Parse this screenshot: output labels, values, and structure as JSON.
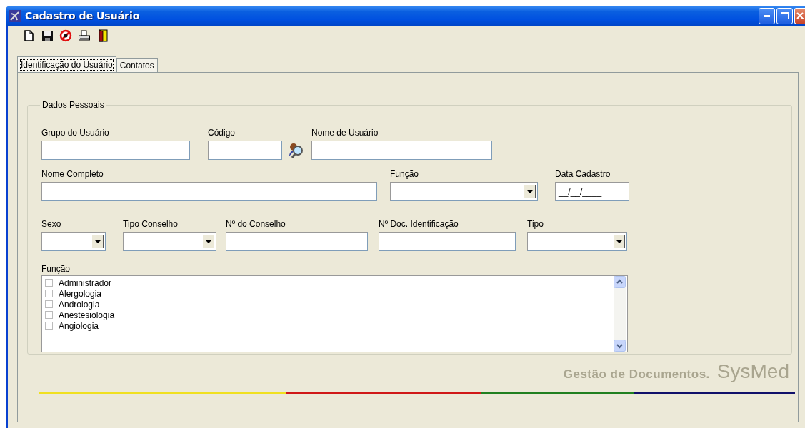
{
  "window": {
    "title": "Cadastro de Usuário"
  },
  "toolbar": [
    {
      "kind": "new"
    },
    {
      "kind": "save"
    },
    {
      "kind": "cancel"
    },
    {
      "kind": "print"
    },
    {
      "kind": "exit"
    }
  ],
  "tabs": [
    {
      "label": "Identificação do Usuário",
      "selected": true
    },
    {
      "label": "Contatos",
      "selected": false
    }
  ],
  "group": {
    "title": "Dados Pessoais",
    "fields": [
      {
        "label": "Grupo do Usuário",
        "kind": "text"
      },
      {
        "label": "Código",
        "kind": "lookup"
      },
      {
        "label": "Nome de Usuário",
        "kind": "text"
      },
      {
        "label": "Nome Completo",
        "kind": "text"
      },
      {
        "label": "Função",
        "kind": "combo"
      },
      {
        "label": "Data Cadastro",
        "kind": "text",
        "value": "__/__/____"
      },
      {
        "label": "Sexo",
        "kind": "combo"
      },
      {
        "label": "Tipo Conselho",
        "kind": "combo"
      },
      {
        "label": "Nº do Conselho",
        "kind": "text"
      },
      {
        "label": "Nº Doc. Identificação",
        "kind": "text"
      },
      {
        "label": "Tipo",
        "kind": "combo"
      }
    ],
    "list": {
      "label": "Função",
      "items": [
        {
          "label": "Administrador",
          "checked": false
        },
        {
          "label": "Alergologia",
          "checked": false
        },
        {
          "label": "Andrologia",
          "checked": false
        },
        {
          "label": "Anestesiologia",
          "checked": false
        },
        {
          "label": "Angiologia",
          "checked": false
        }
      ]
    }
  },
  "footer": {
    "caption": "Gestão de Documentos.",
    "brand": "SysMed"
  }
}
